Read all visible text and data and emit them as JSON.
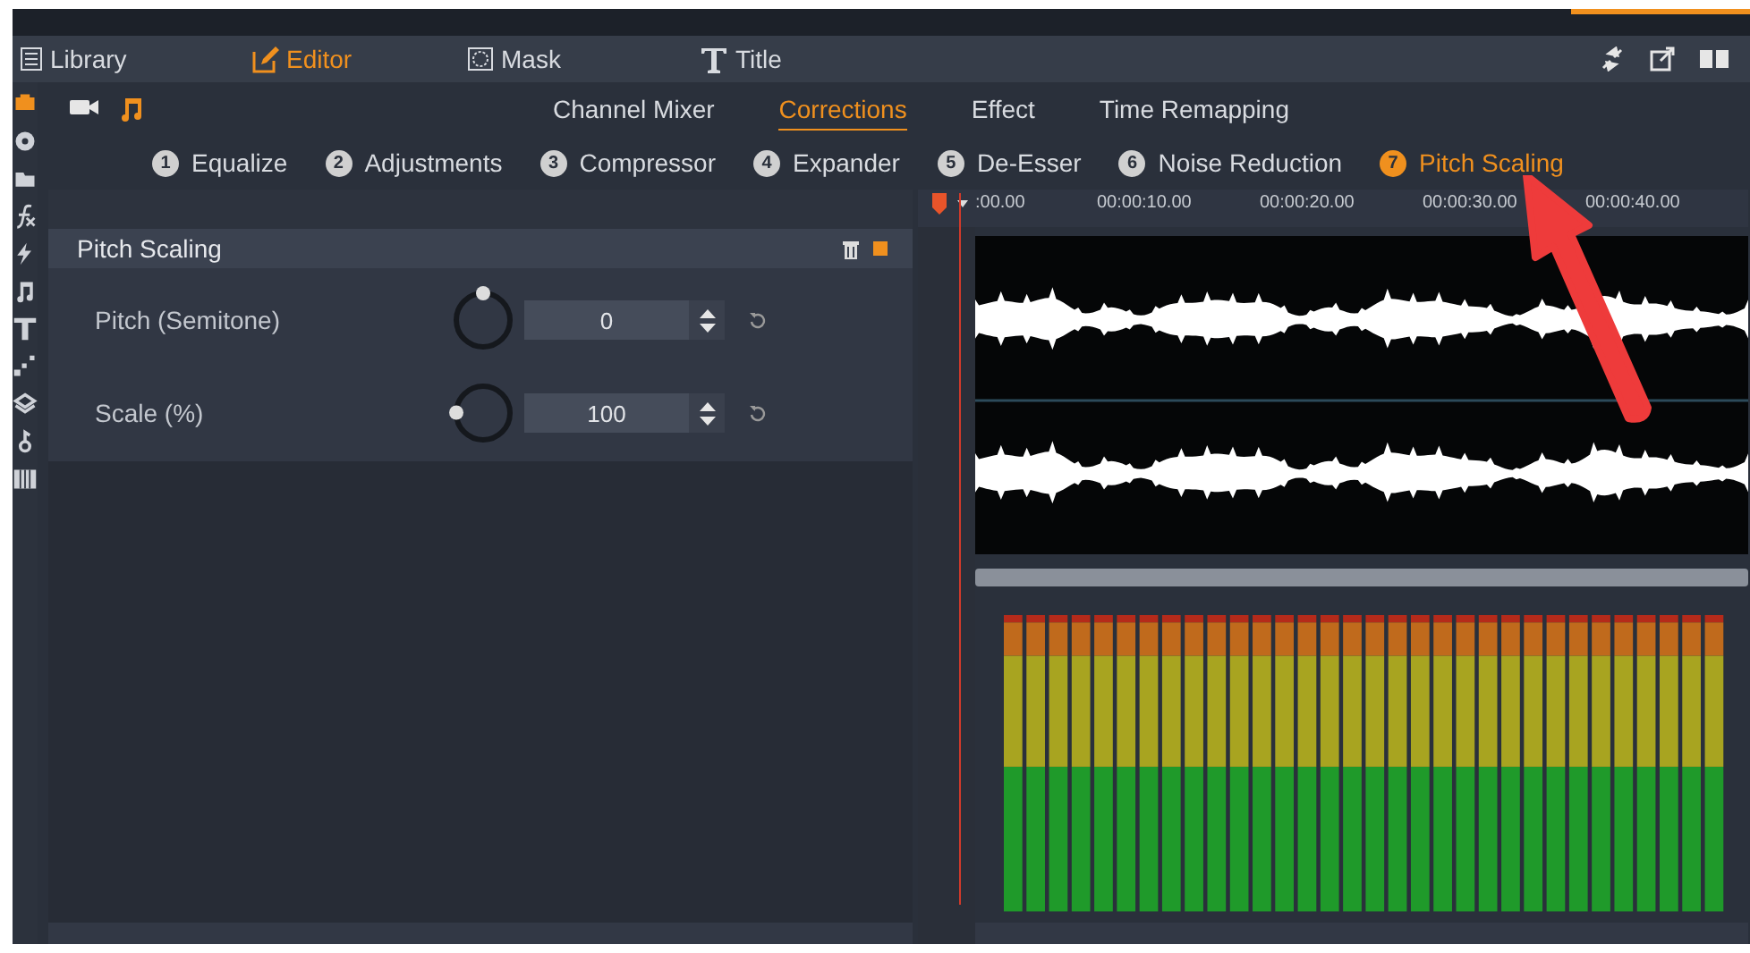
{
  "nav": {
    "items": [
      {
        "label": "Library",
        "selected": false
      },
      {
        "label": "Editor",
        "selected": true
      },
      {
        "label": "Mask",
        "selected": false
      },
      {
        "label": "Title",
        "selected": false
      }
    ]
  },
  "rail": [
    {
      "selected": true
    },
    {
      "selected": false
    },
    {
      "selected": false
    },
    {
      "selected": false
    },
    {
      "selected": false
    },
    {
      "selected": false
    },
    {
      "selected": false
    },
    {
      "selected": false
    },
    {
      "selected": false
    },
    {
      "selected": false
    },
    {
      "selected": false
    }
  ],
  "media_tabs": [
    {
      "selected": false
    },
    {
      "selected": true
    }
  ],
  "tabs": [
    {
      "label": "Channel Mixer",
      "selected": false
    },
    {
      "label": "Corrections",
      "selected": true
    },
    {
      "label": "Effect",
      "selected": false
    },
    {
      "label": "Time Remapping",
      "selected": false
    }
  ],
  "effects": [
    {
      "number": "1",
      "label": "Equalize",
      "selected": false
    },
    {
      "number": "2",
      "label": "Adjustments",
      "selected": false
    },
    {
      "number": "3",
      "label": "Compressor",
      "selected": false
    },
    {
      "number": "4",
      "label": "Expander",
      "selected": false
    },
    {
      "number": "5",
      "label": "De-Esser",
      "selected": false
    },
    {
      "number": "6",
      "label": "Noise Reduction",
      "selected": false
    },
    {
      "number": "7",
      "label": "Pitch Scaling",
      "selected": true
    }
  ],
  "panel": {
    "title": "Pitch Scaling",
    "enabled": true,
    "params": [
      {
        "label": "Pitch (Semitone)",
        "value": "0",
        "level": 0.5
      },
      {
        "label": "Scale (%)",
        "value": "100",
        "level": 0.17
      }
    ]
  },
  "ruler": {
    "labels": [
      ":00.00",
      "00:00:10.00",
      "00:00:20.00",
      "00:00:30.00",
      "00:00:40.00"
    ]
  }
}
